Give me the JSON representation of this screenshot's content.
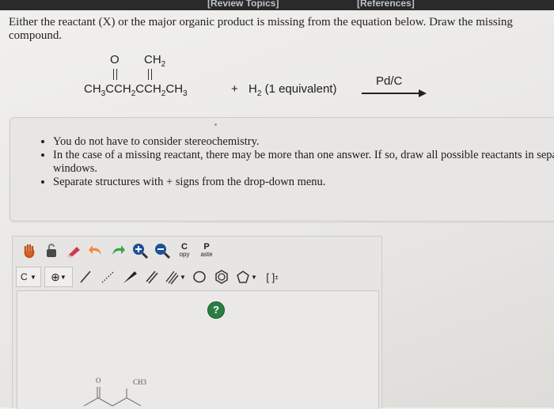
{
  "header": {
    "review_topics": "[Review Topics]",
    "references": "[References]"
  },
  "question": {
    "text": "Either the reactant (X) or the major organic product is missing from the equation below. Draw the missing compound."
  },
  "equation": {
    "top_o": "O",
    "top_ch2": "CH2",
    "chain_parts": [
      "CH",
      "3",
      "CCH",
      "2",
      "CCH",
      "2",
      "CH",
      "3"
    ],
    "plus": "+",
    "reagent_h": "H",
    "reagent_sub": "2",
    "reagent_suffix": "(1 equivalent)",
    "catalyst": "Pd/C"
  },
  "instructions": {
    "items": [
      "You do not have to consider stereochemistry.",
      "In the case of a missing reactant, there may be more than one answer. If so, draw all possible reactants in separate windows.",
      "Separate structures with + signs from the drop-down menu."
    ]
  },
  "toolbar1": {
    "copy_big": "C",
    "copy_small": "opy",
    "paste_big": "P",
    "paste_small": "aste"
  },
  "toolbar2": {
    "element": "C",
    "bracket": "[ ]",
    "bracket_sup": "±"
  },
  "canvas": {
    "help": "?",
    "mol_o": "O",
    "mol_ch3": "CH3"
  }
}
